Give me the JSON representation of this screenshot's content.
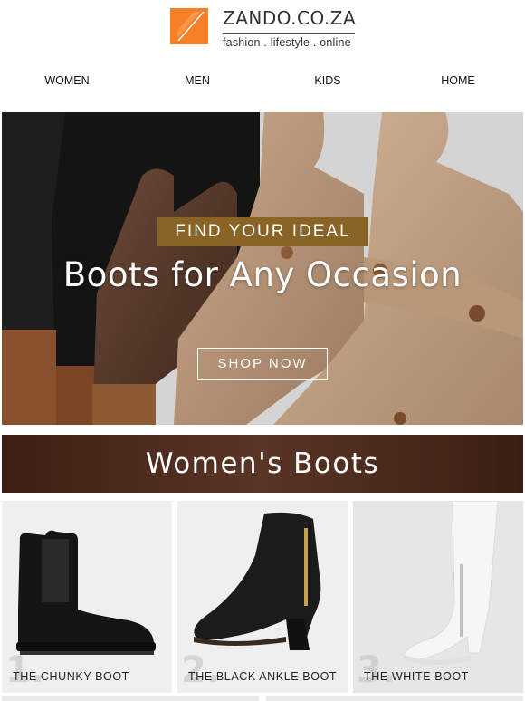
{
  "brand": {
    "name": "ZANDO.CO.ZA",
    "tagline": "fashion . lifestyle . online",
    "accent": "#f58025"
  },
  "nav": {
    "items": [
      {
        "label": "WOMEN"
      },
      {
        "label": "MEN"
      },
      {
        "label": "KIDS"
      },
      {
        "label": "HOME"
      }
    ]
  },
  "hero": {
    "kicker": "FIND YOUR IDEAL",
    "title": "Boots for Any Occasion",
    "cta": "SHOP NOW",
    "kicker_color": "#8a6424"
  },
  "section": {
    "title": "Women's Boots"
  },
  "products": [
    {
      "number": "1.",
      "label": "THE CHUNKY BOOT"
    },
    {
      "number": "2.",
      "label": "THE BLACK ANKLE BOOT"
    },
    {
      "number": "3.",
      "label": "THE WHITE BOOT"
    }
  ]
}
